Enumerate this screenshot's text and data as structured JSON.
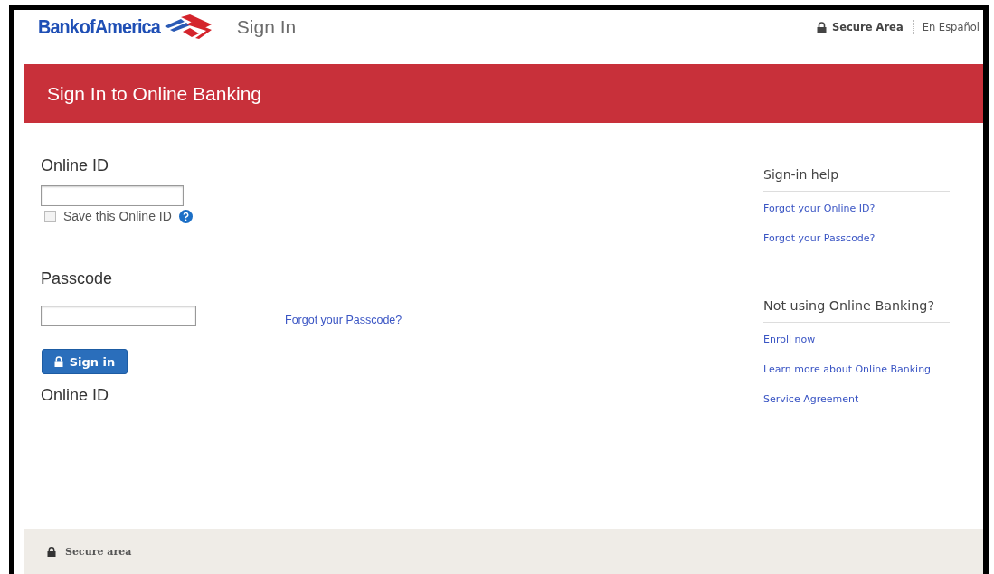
{
  "header": {
    "logo": "Bank of America",
    "page_title": "Sign In",
    "secure_label": "Secure Area",
    "language_link": "En Español"
  },
  "banner": {
    "title": "Sign In to Online Banking"
  },
  "form": {
    "online_id": {
      "label": "Online ID"
    },
    "save_option": {
      "label": "Save this Online ID",
      "checked": false
    },
    "passcode": {
      "label": "Passcode"
    },
    "forgot_link": "Forgot your Passcode?",
    "sign_in_button": "Sign in",
    "cut_label": "Online ID"
  },
  "sidebar": {
    "sections": [
      {
        "heading": "Sign-in help",
        "links": [
          "Forgot your Online ID?",
          "Forgot your Passcode?"
        ]
      },
      {
        "heading": "Not using Online Banking?",
        "links": [
          "Enroll now",
          "Learn more about Online Banking",
          "Service Agreement"
        ]
      }
    ]
  },
  "footer": {
    "secure_label": "Secure area"
  }
}
